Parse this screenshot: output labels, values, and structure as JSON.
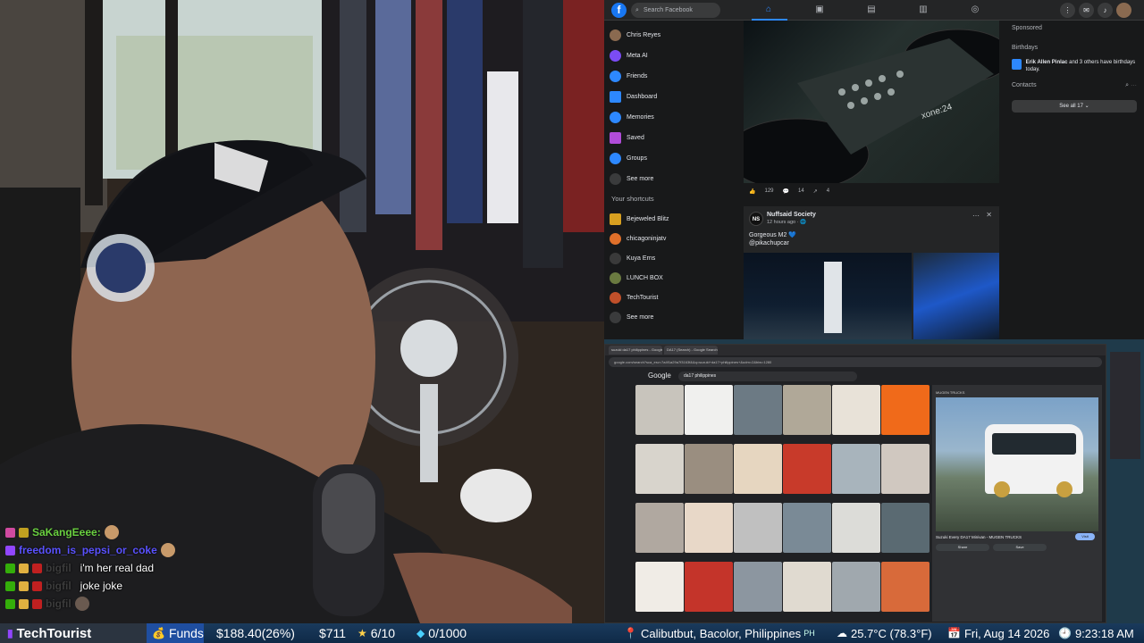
{
  "chat": {
    "messages": [
      {
        "user": "SaKangEeee:",
        "text": "",
        "has_emote": true
      },
      {
        "user": "freedom_is_pepsi_or_coke",
        "text": "",
        "has_emote": true
      },
      {
        "user": "bigfil",
        "text": "i'm her real dad",
        "has_emote": false
      },
      {
        "user": "bigfil",
        "text": "joke joke",
        "has_emote": false
      },
      {
        "user": "bigfil",
        "text": "",
        "has_emote": true
      }
    ]
  },
  "facebook": {
    "search_placeholder": "Search Facebook",
    "sidebar": {
      "items": [
        {
          "label": "Chris Reyes",
          "icon": "avatar-icon",
          "color": "#8a6a50"
        },
        {
          "label": "Meta AI",
          "icon": "meta-ai-icon",
          "color": "#7b4cf5"
        },
        {
          "label": "Friends",
          "icon": "friends-icon",
          "color": "#2d88ff"
        },
        {
          "label": "Dashboard",
          "icon": "dashboard-icon",
          "color": "#2d88ff"
        },
        {
          "label": "Memories",
          "icon": "memories-icon",
          "color": "#2d88ff"
        },
        {
          "label": "Saved",
          "icon": "saved-icon",
          "color": "#b04cd8"
        },
        {
          "label": "Groups",
          "icon": "groups-icon",
          "color": "#2d88ff"
        },
        {
          "label": "See more",
          "icon": "chevron-down-icon",
          "color": "#3a3b3c"
        }
      ],
      "shortcuts_title": "Your shortcuts",
      "shortcuts": [
        {
          "label": "Bejeweled Blitz",
          "color": "#d8a020"
        },
        {
          "label": "chicagoninjatv",
          "color": "#e0702a"
        },
        {
          "label": "Kuya Erns",
          "color": "#3a3a3a"
        },
        {
          "label": "LUNCH BOX",
          "color": "#6a7a40"
        },
        {
          "label": "TechTourist",
          "color": "#c0502a"
        },
        {
          "label": "See more",
          "color": "#3a3b3c"
        }
      ]
    },
    "post1": {
      "likes": "129",
      "comments": "14",
      "shares": "4"
    },
    "post2": {
      "author": "Nuffsaid Society",
      "meta": "12 hours ago · 🌐",
      "line1": "Gorgeous M2 💙",
      "line2": "@pikachupcar"
    },
    "right": {
      "sponsored": "Sponsored",
      "birthdays": "Birthdays",
      "birthday_text_name": "Erik Allen Pinlac",
      "birthday_text_rest": " and 3 others have birthdays today.",
      "contacts": "Contacts",
      "see_all": "See all 17 ⌄"
    }
  },
  "browser": {
    "tabs": [
      "suzuki da17 philippines - Google Search",
      "DA17 (Search) - Google Search"
    ],
    "url": "google.com/search?sca_esv=7a4f1a29a7f3163f&&q=suzuki+da17+philippines+&udm=2&biw=1280",
    "google_logo": "Google",
    "query": "da17 philippines",
    "preview_source": "MUGEN TRUCKS",
    "preview_title": "Suzuki Every DA17 Minivan - MUGEN TRUCKS",
    "visit_label": "Visit",
    "share_label": "Share",
    "save_label": "Save",
    "tile_colors": [
      "#c8c4bc",
      "#f0f0ee",
      "#6c7a84",
      "#b0a898",
      "#e8e2d8",
      "#f06a1a",
      "#d8d4cc",
      "#9a8e80",
      "#e6d6c0",
      "#c83a2a",
      "#a8b4bc",
      "#d0c8c0",
      "#b0a8a0",
      "#e8d8c8",
      "#c0c0c0",
      "#7a8a96",
      "#dcdcd8",
      "#5a6a72",
      "#f0ece6",
      "#c4342a",
      "#8c96a0",
      "#e0dad0",
      "#a0a8ae",
      "#d86a3a"
    ]
  },
  "statusbar": {
    "channel": "TechTourist",
    "funds_label": "Funds",
    "funds_value": "$188.40(26%)",
    "amount": "$711",
    "goal": "6/10",
    "gems": "0/1000",
    "location": "Calibutbut, Bacolor, Philippines",
    "country": "PH",
    "weather": "25.7°C (78.3°F)",
    "date": "Fri, Aug 14 2026",
    "time": "9:23:18 AM"
  }
}
